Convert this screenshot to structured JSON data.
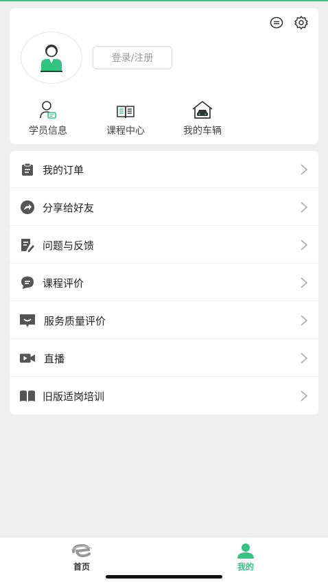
{
  "header": {
    "login_label": "登录/注册",
    "icons": [
      "message-icon",
      "settings-icon"
    ]
  },
  "quick_links": [
    {
      "label": "学员信息",
      "icon": "student-info-icon"
    },
    {
      "label": "课程中心",
      "icon": "book-icon"
    },
    {
      "label": "我的车辆",
      "icon": "car-garage-icon"
    }
  ],
  "menu": [
    {
      "label": "我的订单",
      "icon": "clipboard-icon"
    },
    {
      "label": "分享给好友",
      "icon": "share-icon"
    },
    {
      "label": "问题与反馈",
      "icon": "feedback-icon"
    },
    {
      "label": "课程评价",
      "icon": "comment-icon"
    },
    {
      "label": "服务质量评价",
      "icon": "rating-icon"
    },
    {
      "label": "直播",
      "icon": "video-icon"
    },
    {
      "label": "旧版适岗培训",
      "icon": "open-book-icon"
    }
  ],
  "tabbar": {
    "home_label": "首页",
    "mine_label": "我的",
    "active_color": "#33c481",
    "inactive_color": "#999999"
  },
  "colors": {
    "accent": "#33c481",
    "icon_gray": "#555555"
  }
}
